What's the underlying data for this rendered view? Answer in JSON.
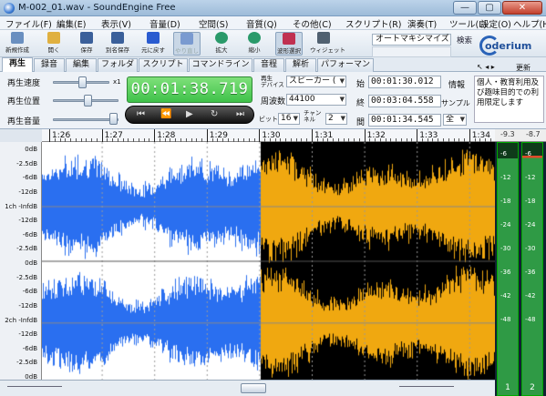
{
  "window": {
    "title": "M-002_01.wav - SoundEngine Free",
    "min": "—",
    "max": "▢",
    "close": "✕"
  },
  "menu": [
    "ファイル(F)",
    "編集(E)",
    "表示(V)",
    "音量(D)",
    "空間(S)",
    "音質(Q)",
    "その他(C)",
    "スクリプト(R)",
    "演奏(T)",
    "ツール(L)",
    "設定(O)",
    "ヘルプ(H)"
  ],
  "toolbar": {
    "buttons": [
      {
        "label": "新規作成",
        "icon": "new-file-icon",
        "color": "#6a8fc0"
      },
      {
        "label": "開く",
        "icon": "open-folder-icon",
        "color": "#e0b040"
      },
      {
        "label": "保存",
        "icon": "save-icon",
        "color": "#3a5f9a"
      },
      {
        "label": "別名保存",
        "icon": "save-as-icon",
        "color": "#3a5f9a"
      },
      {
        "label": "元に戻す",
        "icon": "undo-icon",
        "color": "#2a5bd0"
      },
      {
        "label": "やり直し",
        "icon": "redo-icon",
        "color": "#7a9ad0"
      },
      {
        "label": "拡大",
        "icon": "zoom-in-icon",
        "color": "#2a9a6a"
      },
      {
        "label": "縮小",
        "icon": "zoom-out-icon",
        "color": "#2a9a6a"
      },
      {
        "label": "波形選択",
        "icon": "waveform-select-icon",
        "color": "#c03050"
      },
      {
        "label": "ウィジェット",
        "icon": "widget-icon",
        "color": "#506070"
      }
    ],
    "search_value": "オートマキシマイズ",
    "search_label": "検索",
    "brand": "oderium",
    "update_label": "更新"
  },
  "tabs": [
    "再生",
    "録音",
    "編集",
    "フォルダ",
    "スクリプト",
    "コマンドライン",
    "音程",
    "解析",
    "パフォーマンス"
  ],
  "panel": {
    "speed_label": "再生速度",
    "speed_value_label": "x1",
    "position_label": "再生位置",
    "volume_label": "再生音量",
    "current_time": "00:01:38.719",
    "device_label": "再生\nデバイス",
    "device_value": "スピーカー (",
    "samplerate_label": "周波数",
    "samplerate_value": "44100",
    "bit_label": "ビット",
    "bit_value": "16",
    "channel_label": "チャン\nネル",
    "channel_value": "2",
    "start_label": "始",
    "start_value": "00:01:30.012",
    "end_label": "終",
    "end_value": "00:03:04.558",
    "len_label": "間",
    "len_value": "00:01:34.545",
    "info_label": "情報",
    "sample_label": "サンプル",
    "unit_value": "全",
    "info_text": "個人・教育利用及び趣味目的での利用限定します"
  },
  "transport": [
    "⏮",
    "⏪",
    "▶",
    "↻",
    "⏭"
  ],
  "ruler": [
    "1:26",
    "1:27",
    "1:28",
    "1:29",
    "1:30",
    "1:31",
    "1:32",
    "1:33",
    "1:34"
  ],
  "db_labels": [
    "0dB",
    "-2.5dB",
    "-6dB",
    "-12dB",
    "1ch -InfdB",
    "-12dB",
    "-6dB",
    "-2.5dB",
    "0dB",
    "-2.5dB",
    "-6dB",
    "-12dB",
    "2ch -InfdB",
    "-12dB",
    "-6dB",
    "-2.5dB",
    "0dB"
  ],
  "vu": {
    "top": [
      "-9.3",
      "-8.7"
    ],
    "scale": [
      "-6",
      "-12",
      "-18",
      "-24",
      "-30",
      "-36",
      "-42",
      "-48"
    ],
    "channels": [
      "1",
      "2"
    ],
    "levels": [
      0.06,
      0.05
    ]
  },
  "colors": {
    "selected_wave": "#f0a810",
    "unselected_wave": "#2a6ff0",
    "wave_bg_selected": "#000000",
    "wave_bg": "#ffffff"
  }
}
